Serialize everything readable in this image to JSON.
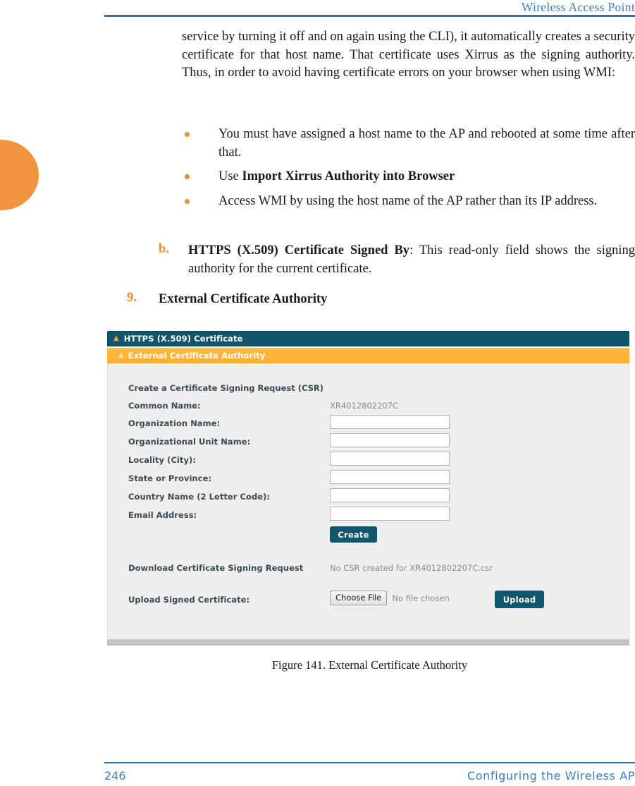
{
  "page": {
    "running_head": "Wireless Access Point",
    "footer_page_number": "246",
    "footer_section": "Configuring the Wireless AP",
    "figure_caption": "Figure 141. External Certificate Authority"
  },
  "colors": {
    "accent_blue": "#2a72b5",
    "head_text_blue": "#3a7ebd",
    "accent_orange": "#f08a35",
    "margin_tab_orange": "#f2943f",
    "panel_teal": "#10556b",
    "panel_amber": "#fdb940",
    "button_teal": "#10566c",
    "panel_body_gray": "#eeeeee"
  },
  "body": {
    "paragraph": "service by turning it off and on again using the CLI), it automatically creates a security certificate for that host name. That certificate uses Xirrus as the signing authority. Thus, in order to avoid having certificate errors on your browser when using WMI:",
    "bullets": [
      {
        "text_before": "You must have assigned a host name to the AP and rebooted at some time after that.",
        "bold": "",
        "text_after": ""
      },
      {
        "text_before": "Use ",
        "bold": "Import Xirrus Authority into Browser",
        "text_after": ""
      },
      {
        "text_before": "Access WMI by using the host name of the AP rather than its IP address.",
        "bold": "",
        "text_after": ""
      }
    ],
    "item_b": {
      "marker": "b.",
      "bold": "HTTPS (X.509) Certificate Signed By",
      "rest": ": This read-only field shows the signing authority for the current certificate."
    },
    "item_9": {
      "marker": "9.",
      "label": "External Certificate Authority"
    }
  },
  "screenshot": {
    "panel_title": "HTTPS (X.509) Certificate",
    "subpanel_title": "External Certificate Authority",
    "collapse_icon": "chevron-up-icon",
    "section_heading": "Create a Certificate Signing Request (CSR)",
    "fields": [
      {
        "label": "Common Name:",
        "type": "readonly",
        "value": "XR4012802207C"
      },
      {
        "label": "Organization Name:",
        "type": "input",
        "value": ""
      },
      {
        "label": "Organizational Unit Name:",
        "type": "input",
        "value": ""
      },
      {
        "label": "Locality (City):",
        "type": "input",
        "value": ""
      },
      {
        "label": "State or Province:",
        "type": "input",
        "value": ""
      },
      {
        "label": "Country Name (2 Letter Code):",
        "type": "input",
        "value": ""
      },
      {
        "label": "Email Address:",
        "type": "input",
        "value": ""
      }
    ],
    "create_button": "Create",
    "download_label": "Download Certificate Signing Request",
    "download_status": "No CSR created for XR4012802207C.csr",
    "upload_label": "Upload Signed Certificate:",
    "choose_file_button": "Choose File",
    "no_file_text": "No file chosen",
    "upload_button": "Upload"
  }
}
